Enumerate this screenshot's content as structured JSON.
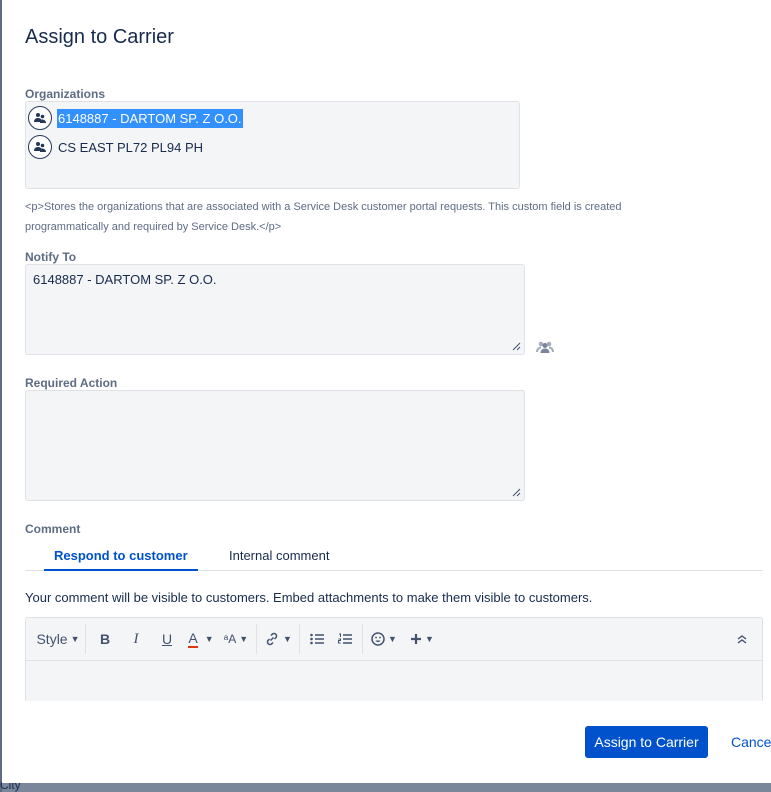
{
  "dialog": {
    "title": "Assign to Carrier"
  },
  "organizations": {
    "label": "Organizations",
    "items": [
      {
        "name": "6148887 - DARTOM SP. Z O.O.",
        "selected": true
      },
      {
        "name": "CS EAST PL72 PL94 PH",
        "selected": false
      }
    ],
    "help": "<p>Stores the organizations that are associated with a Service Desk customer portal requests. This custom field is created programmatically and required by Service Desk.</p>"
  },
  "notify_to": {
    "label": "Notify To",
    "value": "6148887 - DARTOM SP. Z O.O."
  },
  "required_action": {
    "label": "Required Action",
    "value": ""
  },
  "comment": {
    "label": "Comment",
    "tabs": [
      {
        "label": "Respond to customer",
        "active": true
      },
      {
        "label": "Internal comment",
        "active": false
      }
    ],
    "visibility_note": "Your comment will be visible to customers. Embed attachments to make them visible to customers.",
    "toolbar": {
      "style_label": "Style",
      "bold": "B",
      "italic": "I",
      "underline": "U",
      "text_color": "A",
      "more_formatting": "ᵃA",
      "link_icon": "link-icon",
      "bullet_list_icon": "bullet-list-icon",
      "numbered_list_icon": "numbered-list-icon",
      "emoji_icon": "emoji-icon",
      "insert_icon": "plus-icon",
      "collapse_icon": "double-chevron-up-icon"
    }
  },
  "actions": {
    "primary": "Assign to Carrier",
    "cancel": "Cancel"
  },
  "background": {
    "partial_text": "City"
  },
  "colors": {
    "primary": "#0052cc",
    "selection": "#3390ff",
    "text_color_underline": "#de350b"
  }
}
